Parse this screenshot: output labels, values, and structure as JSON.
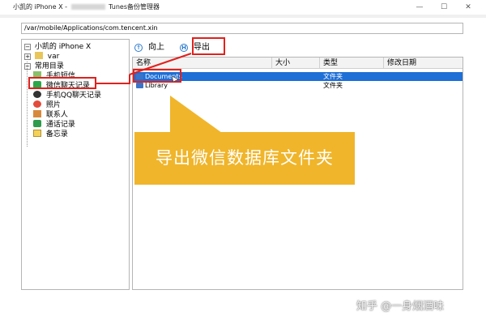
{
  "window": {
    "title_prefix": "小凯的 iPhone X -",
    "title_suffix": "Tunes备份管理器",
    "min_glyph": "—",
    "max_glyph": "☐",
    "close_glyph": "✕"
  },
  "path": "/var/mobile/Applications/com.tencent.xin",
  "tree": {
    "root": "小凯的 iPhone X",
    "items": [
      {
        "label": "var",
        "icon": "folder-icon"
      },
      {
        "label": "常用目录",
        "icon": "folder-icon"
      },
      {
        "label": "手机短信",
        "icon": "sms-icon"
      },
      {
        "label": "微信聊天记录",
        "icon": "wechat-icon"
      },
      {
        "label": "手机QQ聊天记录",
        "icon": "qq-icon"
      },
      {
        "label": "照片",
        "icon": "photo-icon"
      },
      {
        "label": "联系人",
        "icon": "contacts-icon"
      },
      {
        "label": "通话记录",
        "icon": "phone-icon"
      },
      {
        "label": "备忘录",
        "icon": "notes-icon"
      }
    ]
  },
  "toolbar": {
    "up_label": "向上",
    "export_label": "导出"
  },
  "list": {
    "columns": [
      "名称",
      "大小",
      "类型",
      "修改日期"
    ],
    "rows": [
      {
        "name": "Documents",
        "size": "",
        "type": "文件夹",
        "date": ""
      },
      {
        "name": "Library",
        "size": "",
        "type": "文件夹",
        "date": ""
      }
    ]
  },
  "callout": "导出微信数据库文件夹",
  "watermark": "知乎 @一身烟酒味",
  "colors": {
    "highlight_red": "#e0211e",
    "callout_yellow": "#f0b52a",
    "selection_blue": "#1e6fd6"
  }
}
